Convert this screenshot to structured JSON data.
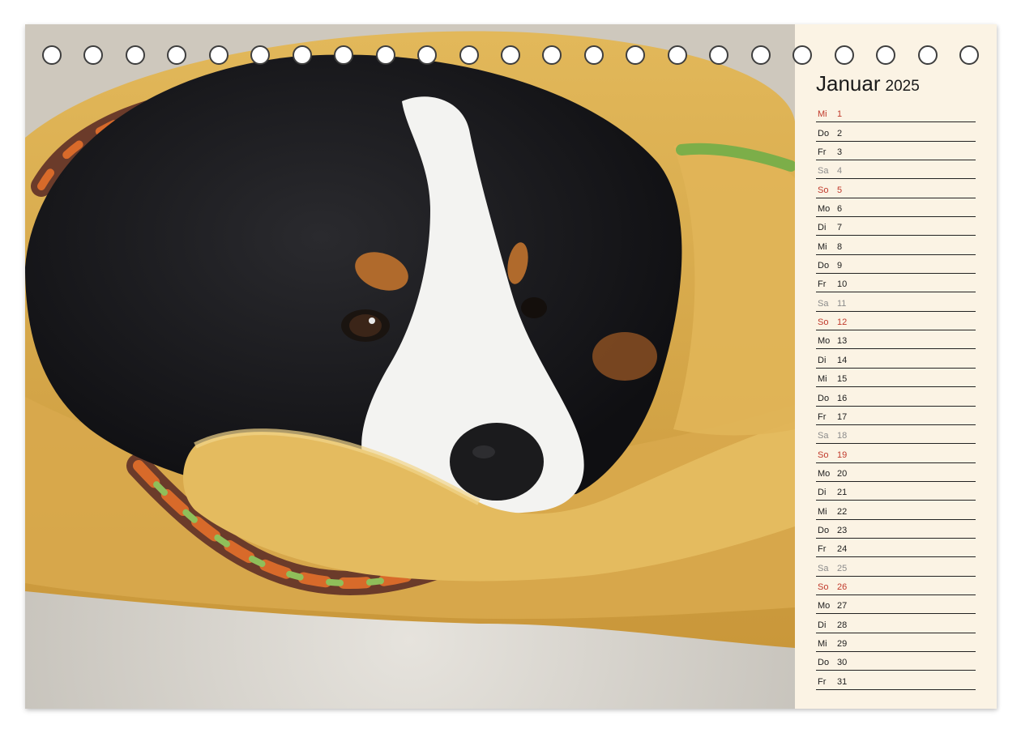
{
  "calendar": {
    "month": "Januar",
    "year": "2025",
    "days": [
      {
        "weekday": "Mi",
        "day": "1",
        "type": "holiday"
      },
      {
        "weekday": "Do",
        "day": "2",
        "type": "weekday"
      },
      {
        "weekday": "Fr",
        "day": "3",
        "type": "weekday"
      },
      {
        "weekday": "Sa",
        "day": "4",
        "type": "saturday"
      },
      {
        "weekday": "So",
        "day": "5",
        "type": "sunday"
      },
      {
        "weekday": "Mo",
        "day": "6",
        "type": "weekday"
      },
      {
        "weekday": "Di",
        "day": "7",
        "type": "weekday"
      },
      {
        "weekday": "Mi",
        "day": "8",
        "type": "weekday"
      },
      {
        "weekday": "Do",
        "day": "9",
        "type": "weekday"
      },
      {
        "weekday": "Fr",
        "day": "10",
        "type": "weekday"
      },
      {
        "weekday": "Sa",
        "day": "11",
        "type": "saturday"
      },
      {
        "weekday": "So",
        "day": "12",
        "type": "sunday"
      },
      {
        "weekday": "Mo",
        "day": "13",
        "type": "weekday"
      },
      {
        "weekday": "Di",
        "day": "14",
        "type": "weekday"
      },
      {
        "weekday": "Mi",
        "day": "15",
        "type": "weekday"
      },
      {
        "weekday": "Do",
        "day": "16",
        "type": "weekday"
      },
      {
        "weekday": "Fr",
        "day": "17",
        "type": "weekday"
      },
      {
        "weekday": "Sa",
        "day": "18",
        "type": "saturday"
      },
      {
        "weekday": "So",
        "day": "19",
        "type": "sunday"
      },
      {
        "weekday": "Mo",
        "day": "20",
        "type": "weekday"
      },
      {
        "weekday": "Di",
        "day": "21",
        "type": "weekday"
      },
      {
        "weekday": "Mi",
        "day": "22",
        "type": "weekday"
      },
      {
        "weekday": "Do",
        "day": "23",
        "type": "weekday"
      },
      {
        "weekday": "Fr",
        "day": "24",
        "type": "weekday"
      },
      {
        "weekday": "Sa",
        "day": "25",
        "type": "saturday"
      },
      {
        "weekday": "So",
        "day": "26",
        "type": "sunday"
      },
      {
        "weekday": "Mo",
        "day": "27",
        "type": "weekday"
      },
      {
        "weekday": "Di",
        "day": "28",
        "type": "weekday"
      },
      {
        "weekday": "Mi",
        "day": "29",
        "type": "weekday"
      },
      {
        "weekday": "Do",
        "day": "30",
        "type": "weekday"
      },
      {
        "weekday": "Fr",
        "day": "31",
        "type": "weekday"
      }
    ]
  },
  "binding": {
    "ring_count": 23
  },
  "photo": {
    "subject": "bernese-mountain-dog-puppy-photo"
  },
  "colors": {
    "page_bg": "#fbf3e4",
    "sunday": "#c0392b",
    "saturday": "#8b8b8b",
    "text": "#1c1c1c",
    "ring_stroke": "#3e3e3e"
  }
}
